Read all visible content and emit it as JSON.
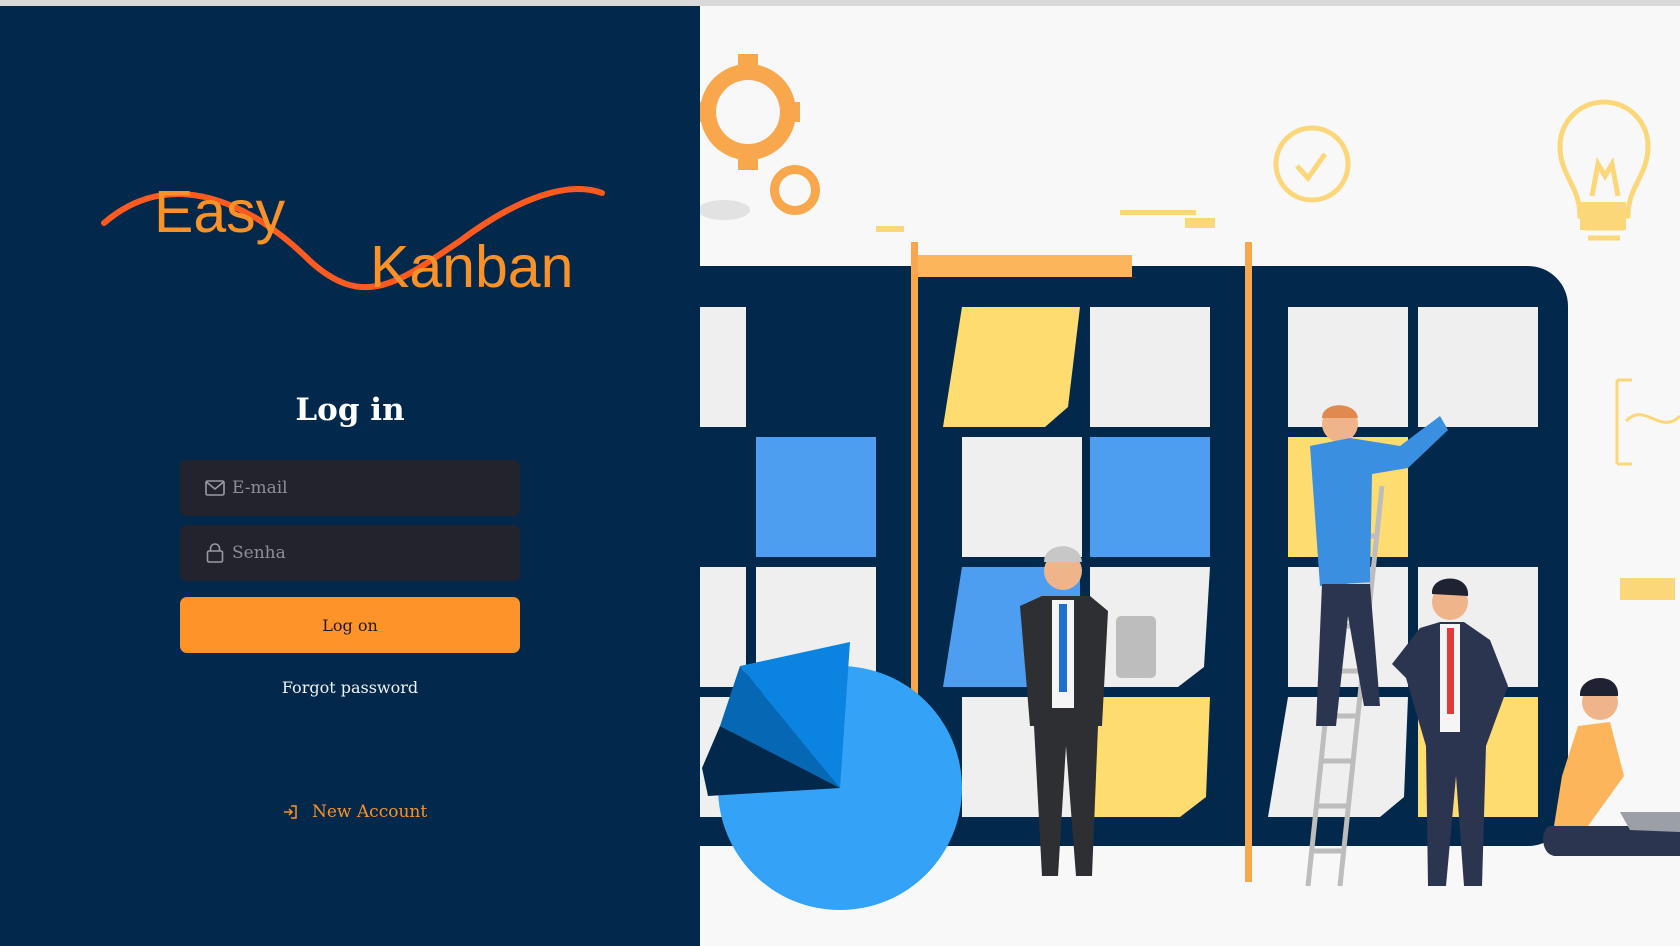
{
  "logo": {
    "word1": "Easy",
    "word2": "Kanban"
  },
  "login": {
    "title": "Log in",
    "email_placeholder": "E-mail",
    "password_placeholder": "Senha",
    "submit_label": "Log on",
    "forgot_label": "Forgot password",
    "new_account_label": "New Account"
  },
  "icons": {
    "email": "mail-icon",
    "password": "lock-icon",
    "new_account": "sign-in-arrow-icon"
  },
  "colors": {
    "panel_bg": "#02294b",
    "accent": "#fe9329",
    "field_bg": "#23232e",
    "logo_wave": "#ff5a1f"
  }
}
